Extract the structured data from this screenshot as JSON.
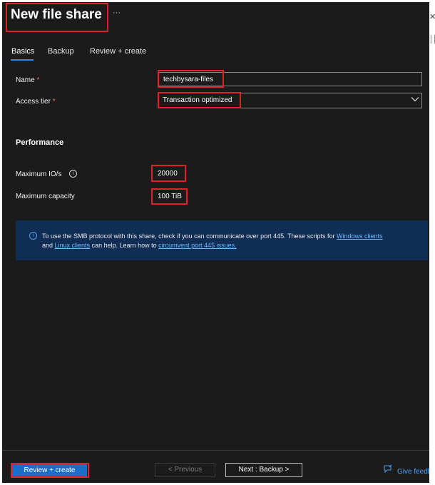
{
  "header": {
    "title": "New file share",
    "more": "···"
  },
  "tabs": [
    {
      "label": "Basics"
    },
    {
      "label": "Backup"
    },
    {
      "label": "Review + create"
    }
  ],
  "form": {
    "name_label": "Name",
    "required_mark": "*",
    "name_value": "techbysara-files",
    "tier_label": "Access tier",
    "tier_value": "Transaction optimized"
  },
  "performance": {
    "title": "Performance",
    "io_label": "Maximum IO/s",
    "io_value": "20000",
    "cap_label": "Maximum capacity",
    "cap_value": "100 TiB"
  },
  "banner": {
    "text1": "To use the SMB protocol with this share, check if you can communicate over port 445. These scripts for ",
    "link1": "Windows clients",
    "text2": "and ",
    "link2": "Linux clients",
    "text3": " can help. Learn how to ",
    "link3": "circumvent port 445 issues."
  },
  "footer": {
    "review_label": "Review + create",
    "prev_label": "< Previous",
    "next_label": "Next : Backup >",
    "feedback_label": "Give feedback"
  },
  "colors": {
    "panel_bg": "#1b1b1b",
    "accent": "#1a6ec8",
    "highlight": "#e0202a",
    "banner_bg": "#0f2d55",
    "link": "#6cb8ff"
  }
}
